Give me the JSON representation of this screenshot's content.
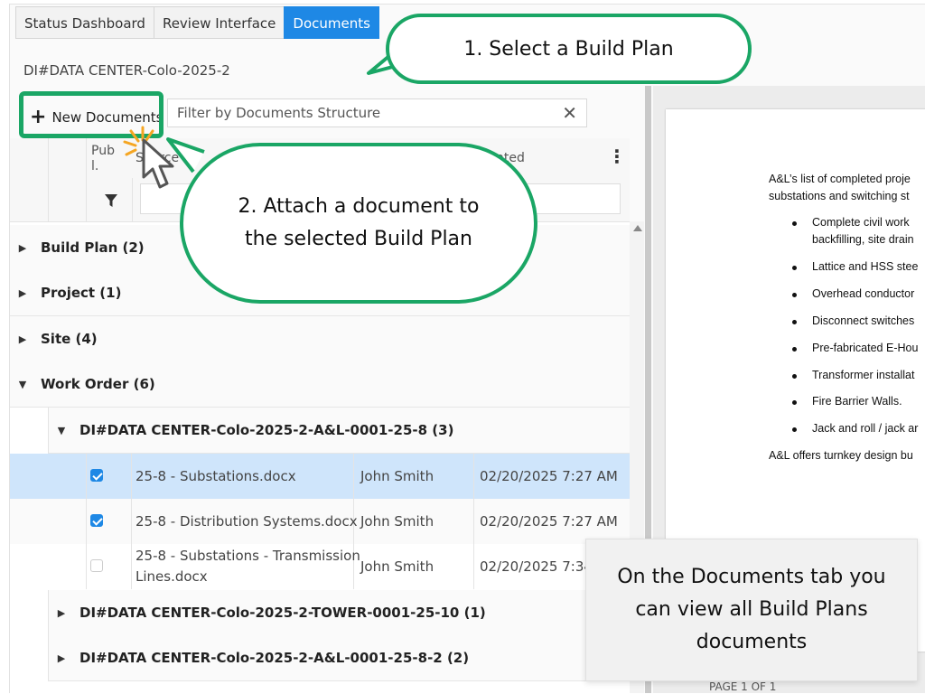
{
  "tabs": [
    "Status Dashboard",
    "Review Interface",
    "Documents"
  ],
  "active_tab": "Documents",
  "subtitle": "DI#DATA CENTER-Colo-2025-2",
  "toolbar": {
    "new_label": "New Documents",
    "filter_placeholder": "Filter by Documents Structure",
    "clear_icon": "close-icon"
  },
  "columns": {
    "published": "Pub l.",
    "source": "Source",
    "updated": "...ated"
  },
  "groups": [
    {
      "label": "Build Plan (2)",
      "expanded": false
    },
    {
      "label": "Project (1)",
      "expanded": false
    },
    {
      "label": "Site (4)",
      "expanded": false
    },
    {
      "label": "Work Order (6)",
      "expanded": true
    }
  ],
  "subgroups": [
    {
      "label": "DI#DATA CENTER-Colo-2025-2-A&L-0001-25-8 (3)",
      "expanded": true
    },
    {
      "label": "DI#DATA CENTER-Colo-2025-2-TOWER-0001-25-10 (1)",
      "expanded": false
    },
    {
      "label": "DI#DATA CENTER-Colo-2025-2-A&L-0001-25-8-2 (2)",
      "expanded": false
    }
  ],
  "rows": [
    {
      "name": "25-8 - Substations.docx",
      "by": "John Smith",
      "date": "02/20/2025 7:27 AM",
      "checked": true,
      "selected": true
    },
    {
      "name": "25-8 - Distribution Systems.docx",
      "by": "John Smith",
      "date": "02/20/2025 7:27 AM",
      "checked": true,
      "selected": false
    },
    {
      "name_line1": "25-8 - Substations - Transmission",
      "name_line2": "Lines.docx",
      "by": "John Smith",
      "date": "02/20/2025 7:34",
      "checked": false,
      "selected": false
    }
  ],
  "preview": {
    "intro_line1": "A&L’s list of completed proje",
    "intro_line2": "substations and switching st",
    "bullets": [
      "Complete civil work",
      "backfilling, site drain",
      "Lattice and HSS stee",
      "Overhead conductor",
      "Disconnect switches",
      "Pre-fabricated E-Hou",
      "Transformer installat",
      "Fire Barrier Walls.",
      "Jack and roll / jack ar"
    ],
    "outro": "A&L offers turnkey design bu",
    "page_label": "PAGE 1 OF 1"
  },
  "callouts": {
    "step1": "1. Select a Build Plan",
    "step2_line1": "2. Attach a document to",
    "step2_line2": "the selected Build Plan",
    "info_line1": "On the Documents tab you",
    "info_line2": "can view all Build Plans",
    "info_line3": "documents"
  },
  "colors": {
    "accent": "#1e88e5",
    "callout_border": "#1aa665",
    "selected_row": "#cfe5fb"
  }
}
